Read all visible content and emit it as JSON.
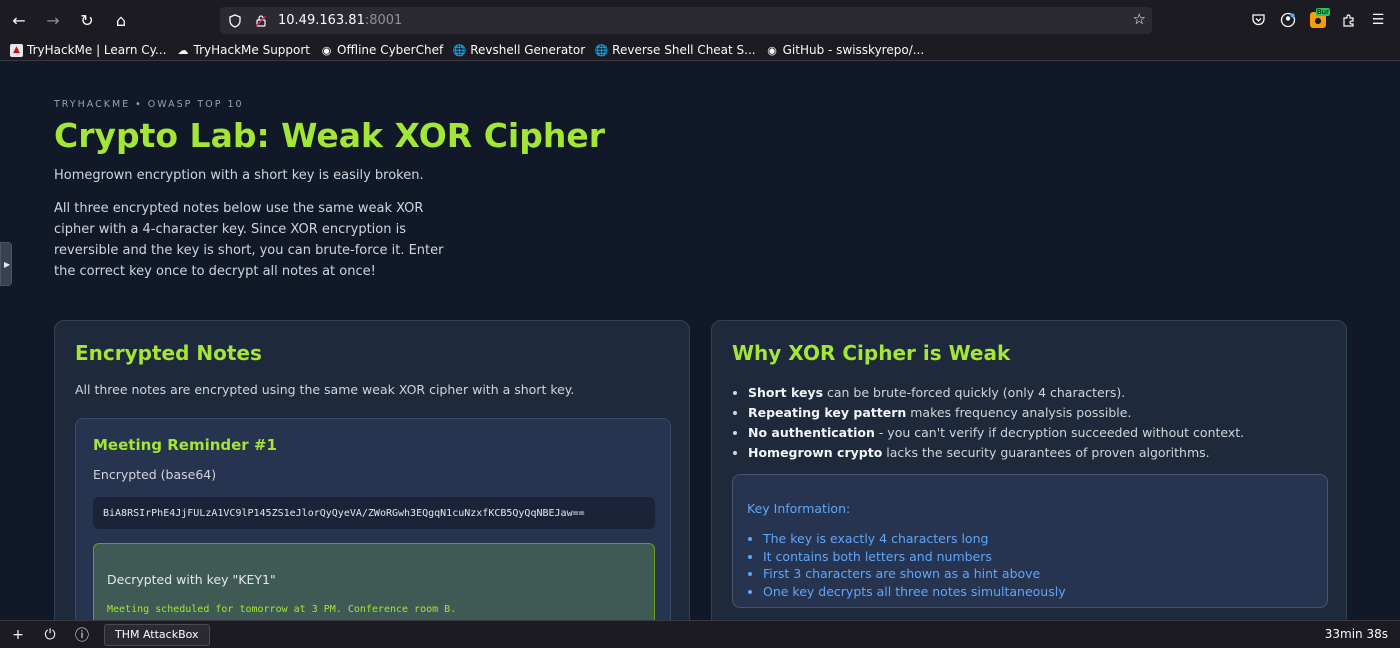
{
  "browser": {
    "url_host": "10.49.163.81",
    "url_port": ":8001",
    "bookmarks": [
      {
        "label": "TryHackMe | Learn Cy...",
        "icon": "tryhackme-icon"
      },
      {
        "label": "TryHackMe Support",
        "icon": "cloud-icon"
      },
      {
        "label": "Offline CyberChef",
        "icon": "chef-icon"
      },
      {
        "label": "Revshell Generator",
        "icon": "globe-icon"
      },
      {
        "label": "Reverse Shell Cheat S...",
        "icon": "globe-icon"
      },
      {
        "label": "GitHub - swisskyrepo/...",
        "icon": "github-icon"
      }
    ],
    "extension_badge": "Bur"
  },
  "header": {
    "eyebrow": "TRYHACKME • OWASP TOP 10",
    "title": "Crypto Lab: Weak XOR Cipher",
    "lead": "Homegrown encryption with a short key is easily broken.",
    "description": "All three encrypted notes below use the same weak XOR cipher with a 4-character key. Since XOR encryption is reversible and the key is short, you can brute-force it. Enter the correct key once to decrypt all notes at once!"
  },
  "notes_card": {
    "title": "Encrypted Notes",
    "subtitle": "All three notes are encrypted using the same weak XOR cipher with a short key.",
    "notes": [
      {
        "title": "Meeting Reminder #1",
        "encrypted_label": "Encrypted (base64)",
        "ciphertext": "BiA8RSIrPhE4JjFULzA1VC9lP145ZS1eJlorQyQyeVA/ZWoRGwh3EQgqN1cuNzxfKCB5QyQqNBEJaw==",
        "decrypted_label": "Decrypted with key \"KEY1\"",
        "plaintext": "Meeting scheduled for tomorrow at 3 PM. Conference room B."
      }
    ]
  },
  "weak_card": {
    "title": "Why XOR Cipher is Weak",
    "reasons": [
      {
        "strong": "Short keys",
        "rest": " can be brute-forced quickly (only 4 characters)."
      },
      {
        "strong": "Repeating key pattern",
        "rest": " makes frequency analysis possible."
      },
      {
        "strong": "No authentication",
        "rest": " - you can't verify if decryption succeeded without context."
      },
      {
        "strong": "Homegrown crypto",
        "rest": " lacks the security guarantees of proven algorithms."
      }
    ],
    "key_info": {
      "heading": "Key Information:",
      "items": [
        "The key is exactly 4 characters long",
        "It contains both letters and numbers",
        "First 3 characters are shown as a hint above",
        "One key decrypts all three notes simultaneously"
      ]
    }
  },
  "taskbar": {
    "app_label": "THM AttackBox",
    "timer": "33min 38s"
  }
}
